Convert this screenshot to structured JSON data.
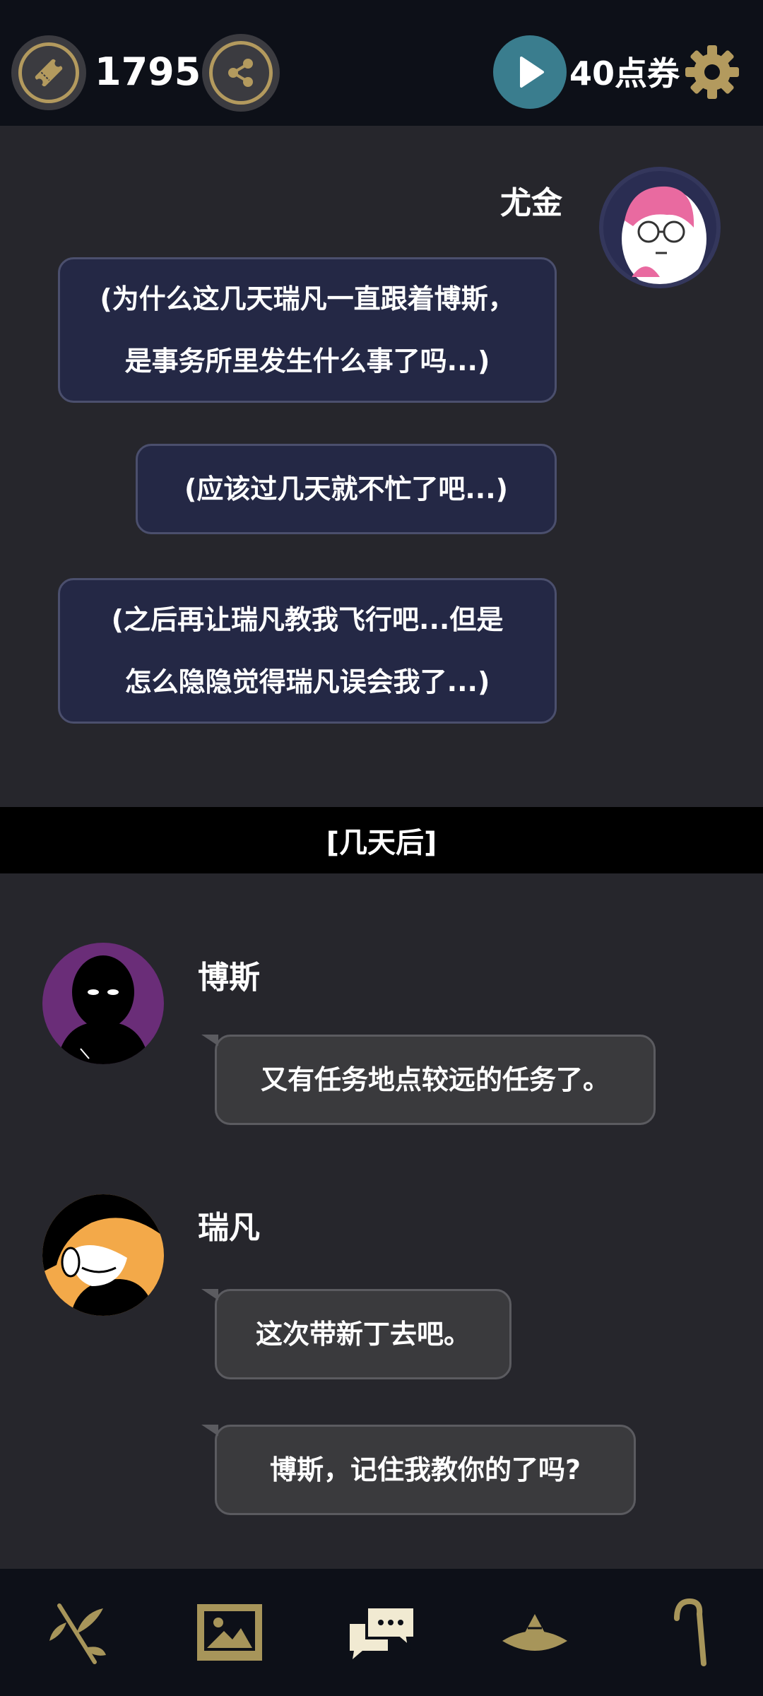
{
  "topbar": {
    "ticket_count": "1795",
    "points_label": "40点券",
    "icons": [
      "ticket-icon",
      "share-icon",
      "play-icon",
      "gear-icon"
    ]
  },
  "messages_before": [
    {
      "speaker": "尤金",
      "lines": [
        "(为什么这几天瑞凡一直跟着博斯，",
        "是事务所里发生什么事了吗...)"
      ]
    },
    {
      "speaker": "尤金",
      "lines": [
        "(应该过几天就不忙了吧...)"
      ]
    },
    {
      "speaker": "尤金",
      "lines": [
        "(之后再让瑞凡教我飞行吧...但是",
        "怎么隐隐觉得瑞凡误会我了...)"
      ]
    }
  ],
  "speaker_eugene": "尤金",
  "time_divider": "[几天后]",
  "speaker_boss": "博斯",
  "boss_message": "又有任务地点较远的任务了。",
  "speaker_ruifan": "瑞凡",
  "ruifan_messages": [
    "这次带新丁去吧。",
    "博斯，记住我教你的了吗?"
  ],
  "bottom_nav": [
    "branch-icon",
    "gallery-icon",
    "chat-icon",
    "hat-icon",
    "cane-icon"
  ],
  "colors": {
    "background": "#26262c",
    "bar": "#0d1018",
    "accent_gold": "#b39a5e",
    "navy_bubble": "#242845",
    "grey_bubble": "#3a3a3d",
    "play_teal": "#3a7d8e"
  }
}
